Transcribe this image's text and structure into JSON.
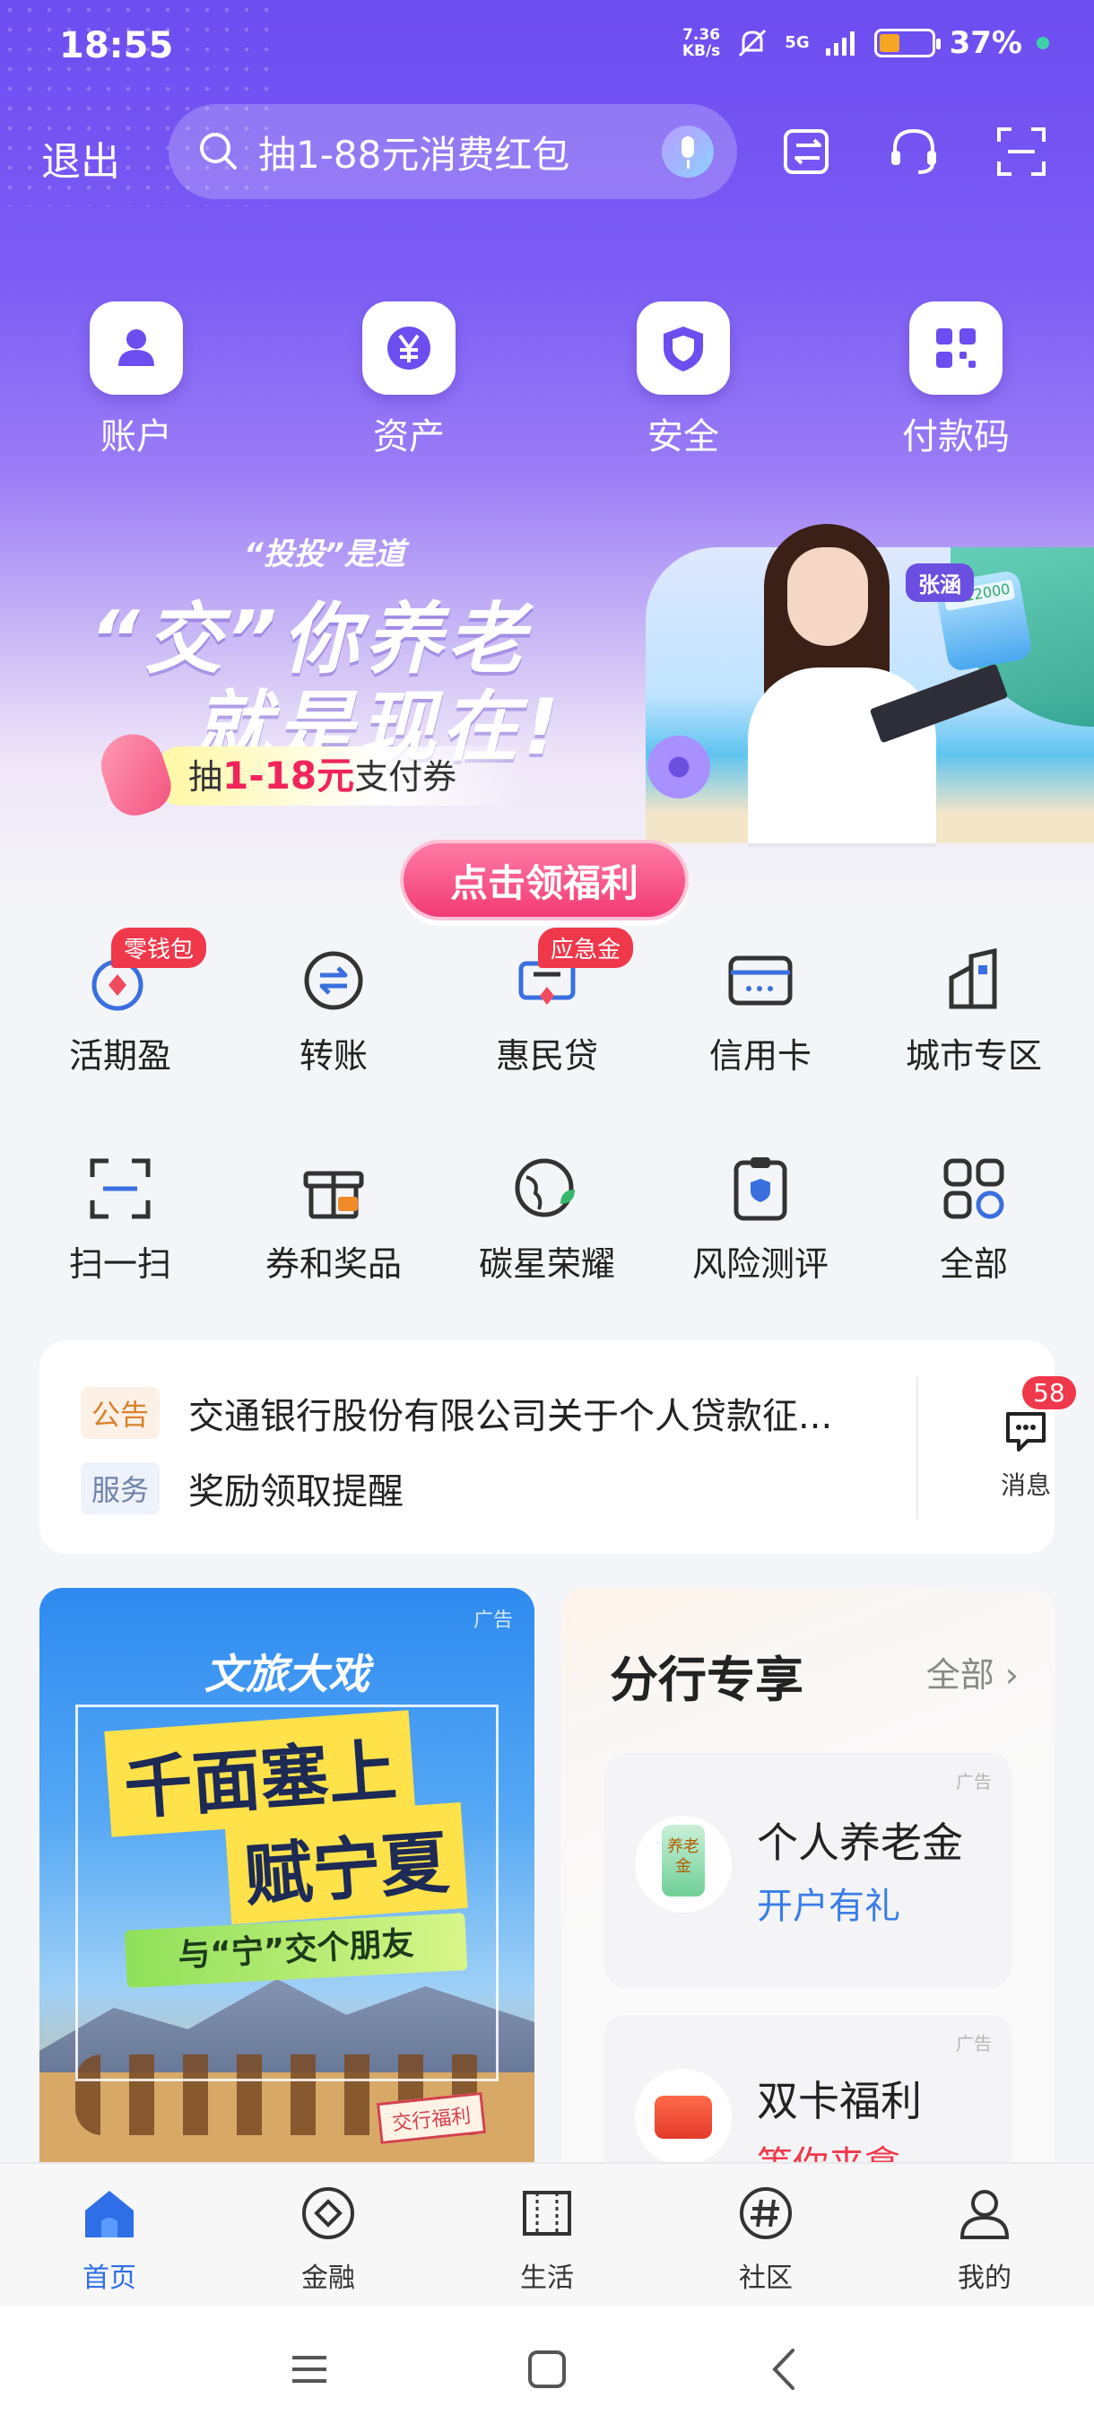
{
  "status": {
    "time": "18:55",
    "netspeed_top": "7.36",
    "netspeed_bottom": "KB/s",
    "network": "5G",
    "battery": "37%"
  },
  "topbar": {
    "logout": "退出",
    "search_placeholder": "抽1-88元消费红包"
  },
  "quick_actions": [
    {
      "label": "账户",
      "icon": "account-icon"
    },
    {
      "label": "资产",
      "icon": "yen-icon"
    },
    {
      "label": "安全",
      "icon": "shield-icon"
    },
    {
      "label": "付款码",
      "icon": "qr-code-icon"
    }
  ],
  "banner": {
    "small": "“投投”是道",
    "line1": "“交”你养老",
    "line2": "就是现在!",
    "coupon_prefix": "抽",
    "coupon_highlight": "1-18元",
    "coupon_suffix": "支付券",
    "tag": "张涵",
    "calc_display": "12000",
    "button": "点击领福利"
  },
  "grid": [
    {
      "label": "活期盈",
      "badge": "零钱包",
      "icon": "coin-icon"
    },
    {
      "label": "转账",
      "badge": "",
      "icon": "transfer-icon"
    },
    {
      "label": "惠民贷",
      "badge": "应急金",
      "icon": "loan-icon"
    },
    {
      "label": "信用卡",
      "badge": "",
      "icon": "credit-card-icon"
    },
    {
      "label": "城市专区",
      "badge": "",
      "icon": "city-icon"
    },
    {
      "label": "扫一扫",
      "badge": "",
      "icon": "scan-icon"
    },
    {
      "label": "券和奖品",
      "badge": "",
      "icon": "gift-icon"
    },
    {
      "label": "碳星荣耀",
      "badge": "",
      "icon": "globe-leaf-icon"
    },
    {
      "label": "风险测评",
      "badge": "",
      "icon": "clipboard-shield-icon"
    },
    {
      "label": "全部",
      "badge": "",
      "icon": "apps-icon"
    }
  ],
  "notices": [
    {
      "tag": "公告",
      "text": "交通银行股份有限公司关于个人贷款征..."
    },
    {
      "tag": "服务",
      "text": "奖励领取提醒"
    }
  ],
  "messages": {
    "label": "消息",
    "count": "58"
  },
  "promo": {
    "ad": "广告",
    "logo": "文旅大戏",
    "headline1": "千面塞上",
    "headline2": "赋宁夏",
    "sub": "与“宁”交个朋友",
    "stamp": "交行福利"
  },
  "branch": {
    "title": "分行专享",
    "all": "全部",
    "cards": [
      {
        "ad": "广告",
        "title": "个人养老金",
        "subtitle": "开户有礼",
        "icon_text": "养老金"
      },
      {
        "ad": "广告",
        "title": "双卡福利",
        "subtitle": "等你来拿"
      }
    ]
  },
  "bottom_nav": [
    {
      "label": "首页",
      "active": true
    },
    {
      "label": "金融",
      "active": false
    },
    {
      "label": "生活",
      "active": false
    },
    {
      "label": "社区",
      "active": false
    },
    {
      "label": "我的",
      "active": false
    }
  ],
  "colors": {
    "brand": "#6c4df0",
    "accent_blue": "#2e6fe8",
    "badge_red": "#f0384b",
    "button_pink": "#f23b74"
  }
}
